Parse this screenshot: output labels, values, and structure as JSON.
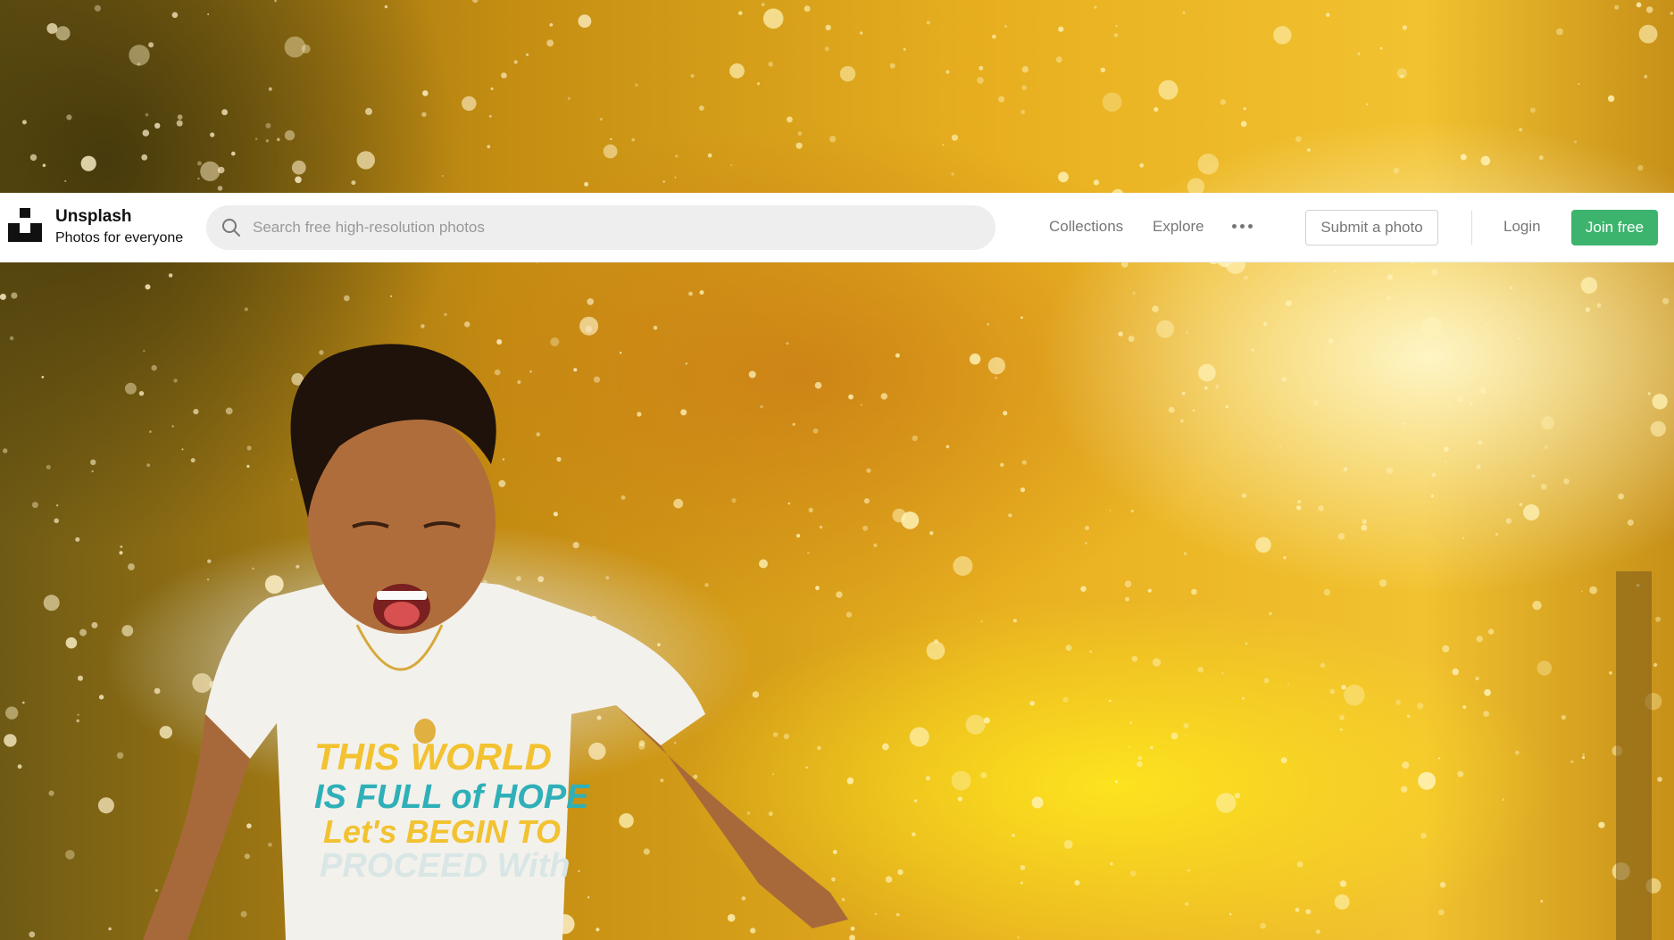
{
  "brand": {
    "name": "Unsplash",
    "tagline": "Photos for everyone"
  },
  "search": {
    "placeholder": "Search free high-resolution photos",
    "icon": "search-icon"
  },
  "nav": {
    "collections": "Collections",
    "explore": "Explore",
    "more_icon": "more-dots-icon"
  },
  "actions": {
    "submit_photo": "Submit a photo",
    "login": "Login",
    "join": "Join free"
  },
  "hero": {
    "shirt_lines": [
      "THIS WORLD",
      "IS FULL of HOPE",
      "Let's BEGIN TO",
      "PROCEED With"
    ]
  },
  "colors": {
    "accent_green": "#3cb46e",
    "search_bg": "#eeeeee",
    "nav_text": "#777777"
  }
}
